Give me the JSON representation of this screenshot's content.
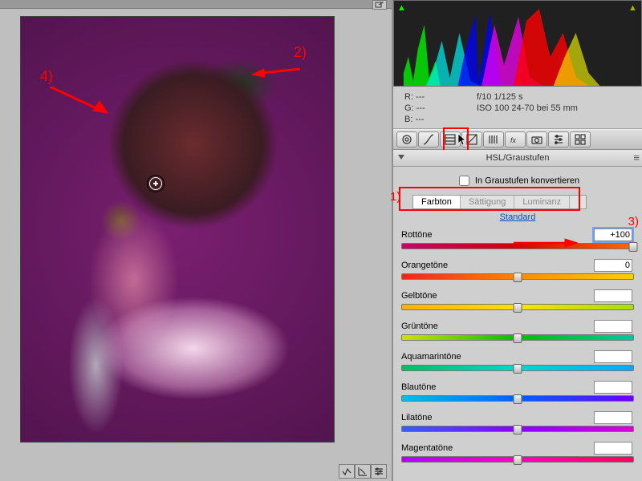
{
  "info": {
    "r": "R:    ---",
    "g": "G:    ---",
    "b": "B:    ---",
    "line1": "f/10    1/125 s",
    "line2": "ISO 100    24-70 bei 55 mm"
  },
  "panel": {
    "title": "HSL/Graustufen",
    "grayscale_label": "In Graustufen konvertieren",
    "standard_link": "Standard",
    "tabs": {
      "hue": "Farbton",
      "sat": "Sättigung",
      "lum": "Luminanz"
    }
  },
  "sliders": [
    {
      "label": "Rottöne",
      "value": "+100",
      "pos": 1.0,
      "grad": "linear-gradient(90deg,#c7006c,#d80000,#ff6a00)"
    },
    {
      "label": "Orangetöne",
      "value": "0",
      "pos": 0.5,
      "grad": "linear-gradient(90deg,#e22,#ff8800,#ffd000)"
    },
    {
      "label": "Gelbtöne",
      "value": "",
      "pos": 0.5,
      "grad": "linear-gradient(90deg,#ffb000,#ffe000,#a6e000)"
    },
    {
      "label": "Grüntöne",
      "value": "",
      "pos": 0.5,
      "grad": "linear-gradient(90deg,#cfe000,#00c000,#00c8a0)"
    },
    {
      "label": "Aquamarintöne",
      "value": "",
      "pos": 0.5,
      "grad": "linear-gradient(90deg,#00c060,#00d8d0,#00aaff)"
    },
    {
      "label": "Blautöne",
      "value": "",
      "pos": 0.5,
      "grad": "linear-gradient(90deg,#00c0e8,#0060ff,#6a00ff)"
    },
    {
      "label": "Lilatöne",
      "value": "",
      "pos": 0.5,
      "grad": "linear-gradient(90deg,#3060ff,#8a00ff,#d800d8)"
    },
    {
      "label": "Magentatöne",
      "value": "",
      "pos": 0.5,
      "grad": "linear-gradient(90deg,#b000ff,#ff00c0,#ff0060)"
    }
  ],
  "annotations": {
    "a1": "1)",
    "a2": "2)",
    "a3": "3)",
    "a4": "4)"
  }
}
